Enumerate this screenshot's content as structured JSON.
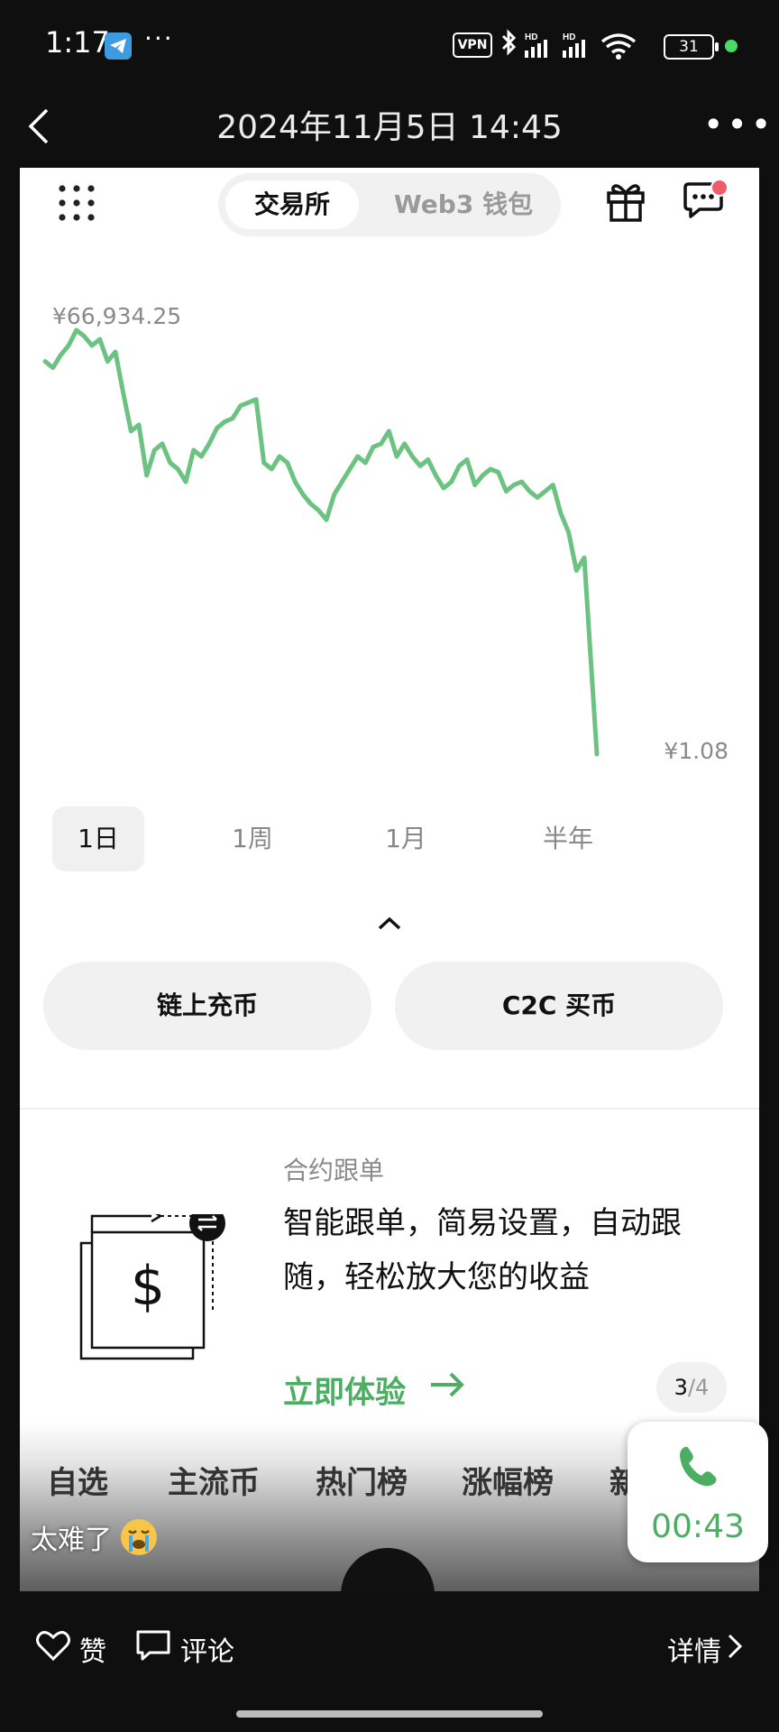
{
  "status_bar": {
    "time": "1:17",
    "dots": "···",
    "vpn": "VPN",
    "battery": "31",
    "icons": [
      "telegram-icon",
      "bluetooth-icon",
      "signal-hd-icon",
      "signal-hd-icon",
      "wifi-icon",
      "battery-icon"
    ]
  },
  "header": {
    "title": "2024年11月5日 14:45",
    "back_icon": "chevron-left-icon",
    "more_icon": "more-dots-icon"
  },
  "app": {
    "segment": {
      "active": "交易所",
      "inactive": "Web3 钱包"
    },
    "chart_labels": {
      "max": "¥66,934.25",
      "min": "¥1.08"
    },
    "ranges": [
      {
        "label": "1日",
        "active": true
      },
      {
        "label": "1周",
        "active": false
      },
      {
        "label": "1月",
        "active": false
      },
      {
        "label": "半年",
        "active": false
      }
    ],
    "buttons": {
      "deposit": "链上充币",
      "c2c": "C2C 买币"
    },
    "promo": {
      "tag": "合约跟单",
      "text": "智能跟单，简易设置，自动跟随，轻松放大您的收益",
      "cta": "立即体验",
      "page": "3",
      "total": "/4"
    },
    "tabs": [
      "自选",
      "主流币",
      "热门榜",
      "涨幅榜",
      "新"
    ]
  },
  "overlay": {
    "caption": "太难了",
    "call_timer": "00:43"
  },
  "bottom_bar": {
    "like": "赞",
    "comment": "评论",
    "detail": "详情"
  },
  "colors": {
    "accent_green": "#4cae63",
    "chart_line": "#6cc381",
    "badge_red": "#ef5b6b"
  },
  "chart_data": {
    "type": "line",
    "title": "",
    "xlabel": "",
    "ylabel": "",
    "range_label": "1日",
    "annotations": [
      "¥66,934.25",
      "¥1.08"
    ],
    "ylim": [
      1.08,
      66934.25
    ],
    "series": [
      {
        "values": [
          62000,
          61000,
          63000,
          64500,
          66934,
          66000,
          64500,
          65500,
          62000,
          63500,
          57000,
          51000,
          52000,
          44000,
          48000,
          49000,
          46000,
          45000,
          43000,
          48000,
          47000,
          49000,
          51500,
          52500,
          53000,
          55000,
          55500,
          56000,
          46000,
          45000,
          47000,
          46000,
          43000,
          41000,
          39500,
          38500,
          37000,
          41000,
          43000,
          45000,
          47000,
          46000,
          48500,
          49000,
          51000,
          47000,
          49000,
          47000,
          45500,
          46500,
          44000,
          42000,
          43000,
          45500,
          46500,
          42500,
          44000,
          45000,
          44500,
          41500,
          42500,
          43000,
          41500,
          40500,
          41500,
          42500,
          38000,
          35000,
          29000,
          31000,
          1.08
        ]
      }
    ]
  }
}
